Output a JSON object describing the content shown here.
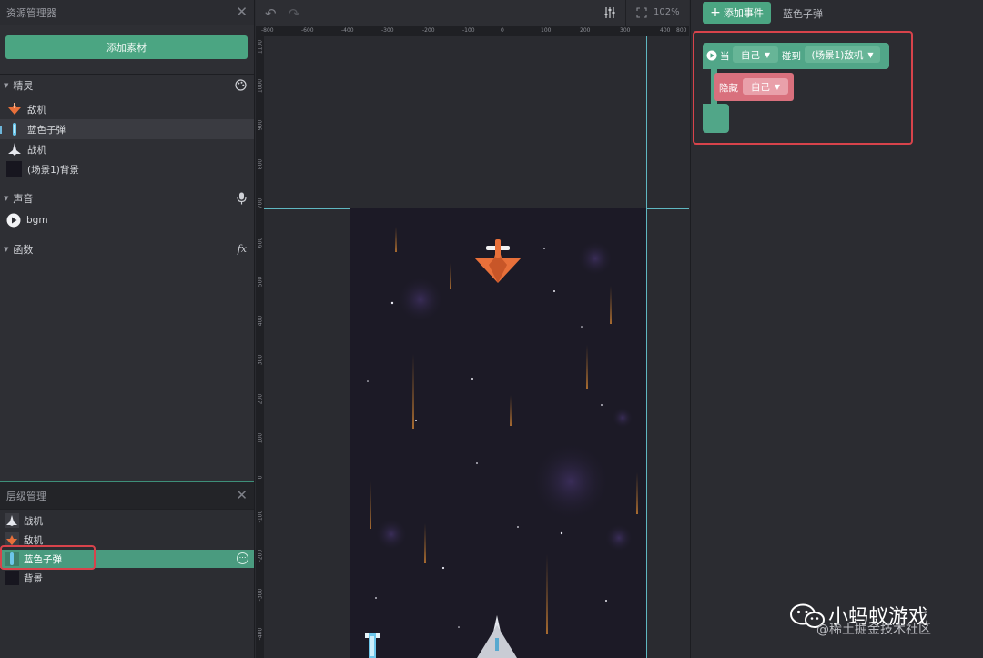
{
  "asset_panel": {
    "title": "资源管理器",
    "add_button": "添加素材",
    "sprites": {
      "header": "精灵",
      "items": [
        "敌机",
        "蓝色子弹",
        "战机",
        "(场景1)背景"
      ]
    },
    "sound": {
      "header": "声音",
      "items": [
        "bgm"
      ]
    },
    "functions": {
      "header": "函数",
      "icon_text": "fx"
    }
  },
  "layer_panel": {
    "title": "层级管理",
    "items": [
      "战机",
      "敌机",
      "蓝色子弹",
      "背景"
    ],
    "selected": "蓝色子弹"
  },
  "canvas": {
    "zoom": "102%",
    "ruler_x": [
      "-800",
      "-600",
      "-400",
      "-300",
      "-200",
      "-100",
      "0",
      "100",
      "200",
      "300",
      "400",
      "800"
    ],
    "ruler_y": [
      "1100",
      "1000",
      "900",
      "800",
      "700",
      "600",
      "500",
      "400",
      "300",
      "200",
      "100",
      "0",
      "-100",
      "-200",
      "-300",
      "-400"
    ]
  },
  "event_panel": {
    "add_event_label": "添加事件",
    "tab_label": "蓝色子弹",
    "when_label": "当",
    "self_chip": "自己",
    "collide_label": "碰到",
    "target_chip": "(场景1)敌机",
    "hide_label": "隐藏",
    "hide_target_chip": "自己"
  },
  "watermark": {
    "main": "小蚂蚁游戏",
    "sub": "@稀土掘金技术社区"
  },
  "colors": {
    "accent": "#4ba582",
    "highlight": "#d8434b",
    "guide": "#5fb7c1",
    "stage_bg": "#1c1a26"
  },
  "icons": [
    "close-icon",
    "palette-icon",
    "microphone-icon",
    "fx-icon",
    "play-icon",
    "undo-icon",
    "redo-icon",
    "sliders-icon",
    "fit-screen-icon",
    "plus-icon",
    "more-icon",
    "wechat-icon"
  ]
}
